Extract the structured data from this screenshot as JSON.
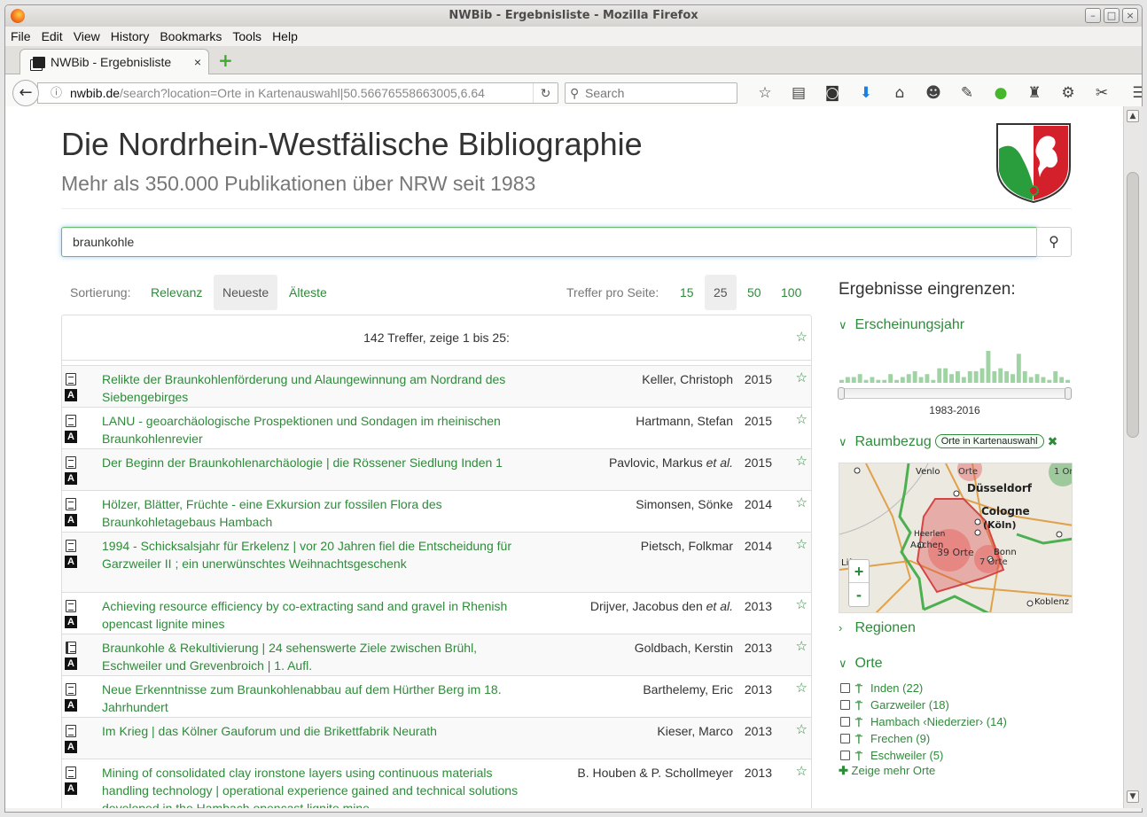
{
  "window": {
    "title": "NWBib - Ergebnisliste - Mozilla Firefox"
  },
  "menu": [
    "File",
    "Edit",
    "View",
    "History",
    "Bookmarks",
    "Tools",
    "Help"
  ],
  "tab": {
    "label": "NWBib - Ergebnisliste",
    "close": "×",
    "new": "+"
  },
  "url": {
    "domain": "nwbib.de",
    "path": "/search?location=Orte in Kartenauswahl|50.56676558663005,6.64"
  },
  "search_bar": {
    "placeholder": "Search"
  },
  "page": {
    "title": "Die Nordrhein-Westfälische Bibliographie",
    "subtitle": "Mehr als 350.000 Publikationen über NRW seit 1983",
    "query": "braunkohle"
  },
  "sort": {
    "label": "Sortierung:",
    "options": [
      "Relevanz",
      "Neueste",
      "Älteste"
    ],
    "active": "Neueste",
    "per_page_label": "Treffer pro Seite:",
    "per_page": [
      "15",
      "25",
      "50",
      "100"
    ],
    "per_page_active": "25"
  },
  "results": {
    "summary": "142 Treffer, zeige 1 bis 25:",
    "items": [
      {
        "title": "Relikte der Braunkohlenförderung und Alaungewinnung am Nordrand des Siebengebirges",
        "author": "Keller, Christoph",
        "etal": "",
        "year": "2015",
        "type": "article"
      },
      {
        "title": "LANU - geoarchäologische Prospektionen und Sondagen im rheinischen Braunkohlenrevier",
        "author": "Hartmann, Stefan",
        "etal": "",
        "year": "2015",
        "type": "article"
      },
      {
        "title": "Der Beginn der Braunkohlenarchäologie | die Rössener Siedlung Inden 1",
        "author": "Pavlovic, Markus",
        "etal": "et al.",
        "year": "2015",
        "type": "article"
      },
      {
        "title": "Hölzer, Blätter, Früchte - eine Exkursion zur fossilen Flora des Braunkohletagebaus Hambach",
        "author": "Simonsen, Sönke",
        "etal": "",
        "year": "2014",
        "type": "article"
      },
      {
        "title": "1994 - Schicksalsjahr für Erkelenz | vor 20 Jahren fiel die Entscheidung für Garzweiler II ; ein unerwünschtes Weihnachtsgeschenk",
        "author": "Pietsch, Folkmar",
        "etal": "",
        "year": "2014",
        "type": "article"
      },
      {
        "title": "Achieving resource efficiency by co-extracting sand and gravel in Rhenish opencast lignite mines",
        "author": "Drijver, Jacobus den",
        "etal": "et al.",
        "year": "2013",
        "type": "article"
      },
      {
        "title": "Braunkohle & Rekultivierung | 24 sehenswerte Ziele zwischen Brühl, Eschweiler und Grevenbroich | 1. Aufl.",
        "author": "Goldbach, Kerstin",
        "etal": "",
        "year": "2013",
        "type": "book"
      },
      {
        "title": "Neue Erkenntnisse zum Braunkohlenabbau auf dem Hürther Berg im 18. Jahrhundert",
        "author": "Barthelemy, Eric",
        "etal": "",
        "year": "2013",
        "type": "article"
      },
      {
        "title": "Im Krieg | das Kölner Gauforum und die Brikettfabrik Neurath",
        "author": "Kieser, Marco",
        "etal": "",
        "year": "2013",
        "type": "article"
      },
      {
        "title": "Mining of consolidated clay ironstone layers using continuous materials handling technology | operational experience gained and technical solutions developed in the Hambach opencast lignite mine",
        "author": "B. Houben & P. Schollmeyer",
        "etal": "",
        "year": "2013",
        "type": "article"
      }
    ]
  },
  "sidebar": {
    "heading": "Ergebnisse eingrenzen:",
    "year_facet": "Erscheinungsjahr",
    "year_range": "1983-2016",
    "histogram": [
      1,
      2,
      2,
      3,
      1,
      2,
      1,
      1,
      3,
      1,
      2,
      3,
      4,
      2,
      3,
      1,
      5,
      5,
      3,
      4,
      2,
      4,
      4,
      5,
      11,
      4,
      5,
      4,
      3,
      10,
      4,
      2,
      3,
      2,
      1,
      4,
      2,
      1
    ],
    "raum_facet": "Raumbezug",
    "raum_badge": "Orte in Kartenauswahl",
    "map_labels": {
      "venlo": "Venlo",
      "duesseldorf": "Düsseldorf",
      "cologne": "Cologne",
      "koeln": "(Köln)",
      "heerlen": "Heerlen",
      "aachen": "Aachen",
      "liege": "Liège",
      "bonn": "Bonn",
      "koblenz": "Koblenz",
      "cluster_a": "39 Orte",
      "cluster_b": "7 Orte",
      "cluster_c": "Orte",
      "cluster_d": "1 Orte"
    },
    "regionen_facet": "Regionen",
    "orte_facet": "Orte",
    "orte": [
      "Inden (22)",
      "Garzweiler (18)",
      "Hambach ‹Niederzier› (14)",
      "Frechen (9)",
      "Eschweiler (5)"
    ],
    "more": "Zeige mehr Orte"
  }
}
